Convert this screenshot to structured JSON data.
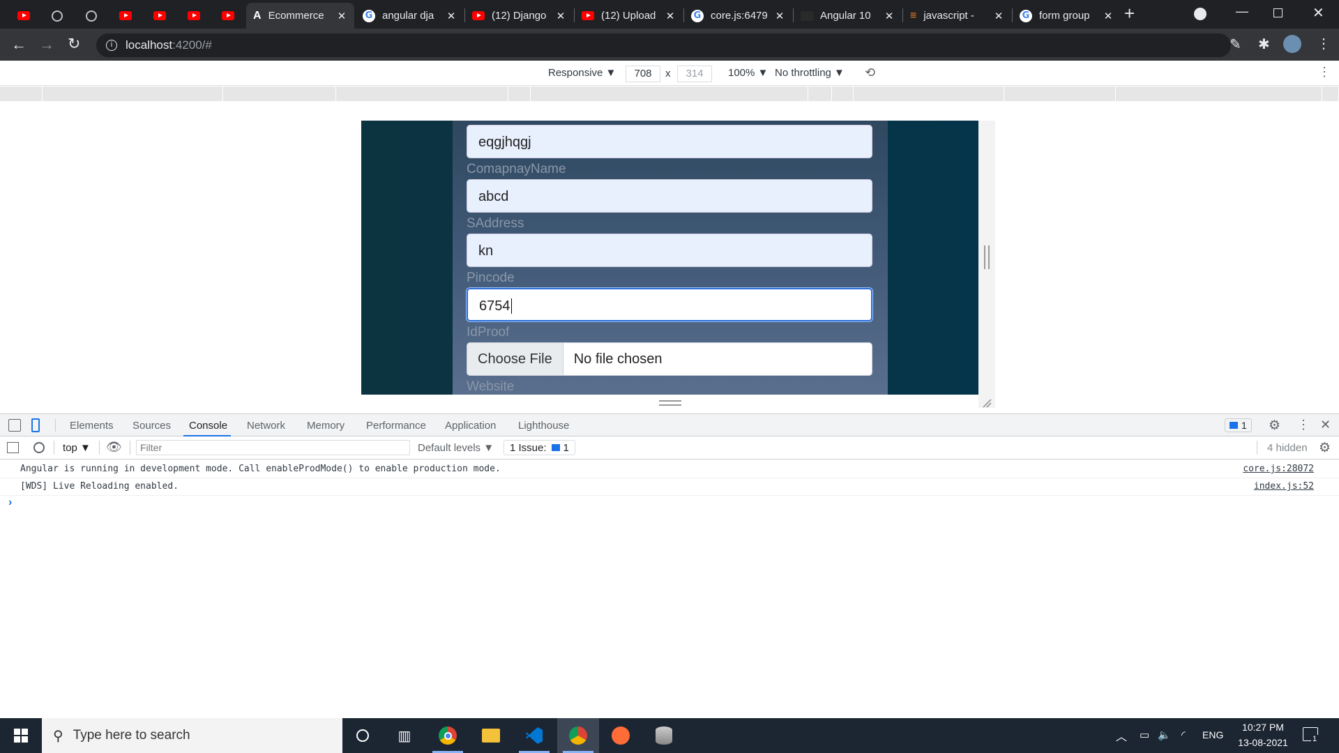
{
  "tabs": [
    {
      "icon": "youtube"
    },
    {
      "icon": "globe"
    },
    {
      "icon": "globe"
    },
    {
      "icon": "youtube"
    },
    {
      "icon": "youtube"
    },
    {
      "icon": "youtube"
    },
    {
      "icon": "youtube"
    },
    {
      "label": "Ecommerce",
      "icon": "angular",
      "active": true
    },
    {
      "label": "angular dja",
      "icon": "google"
    },
    {
      "label": "(12) Django",
      "icon": "youtube"
    },
    {
      "label": "(12) Upload",
      "icon": "youtube"
    },
    {
      "label": "core.js:6479",
      "icon": "google"
    },
    {
      "label": "Angular 10",
      "icon": "dark"
    },
    {
      "label": "javascript -",
      "icon": "stackoverflow"
    },
    {
      "label": "form group",
      "icon": "google"
    }
  ],
  "new_tab": "+",
  "address": {
    "host": "localhost",
    "rest": ":4200/#"
  },
  "device_toolbar": {
    "mode": "Responsive ▼",
    "width": "708",
    "times": "x",
    "height": "314",
    "zoom": "100% ▼",
    "throttle": "No throttling ▼"
  },
  "form": {
    "fields": [
      {
        "label": "",
        "value": "eqgjhqgj"
      },
      {
        "label": "ComapnayName",
        "value": "abcd"
      },
      {
        "label": "SAddress",
        "value": "kn"
      },
      {
        "label": "Pincode",
        "value": "6754"
      }
    ],
    "idproof_label": "IdProof",
    "file_button": "Choose File",
    "file_status": "No file chosen",
    "website_label": "Website"
  },
  "devtools": {
    "tabs": [
      "Elements",
      "Sources",
      "Console",
      "Network",
      "Memory",
      "Performance",
      "Application",
      "Lighthouse"
    ],
    "active_tab": "Console",
    "issues_badge": "1",
    "context": "top ▼",
    "filter_placeholder": "Filter",
    "levels": "Default levels ▼",
    "issue_label": "1 Issue:",
    "issue_count": "1",
    "hidden": "4 hidden",
    "messages": [
      {
        "text": "Angular is running in development mode. Call enableProdMode() to enable production mode.",
        "source": "core.js:28072"
      },
      {
        "text": "[WDS] Live Reloading enabled.",
        "source": "index.js:52"
      }
    ],
    "prompt": "›"
  },
  "taskbar": {
    "search_placeholder": "Type here to search",
    "lang": "ENG",
    "time": "10:27 PM",
    "date": "13-08-2021",
    "notif": "1"
  }
}
